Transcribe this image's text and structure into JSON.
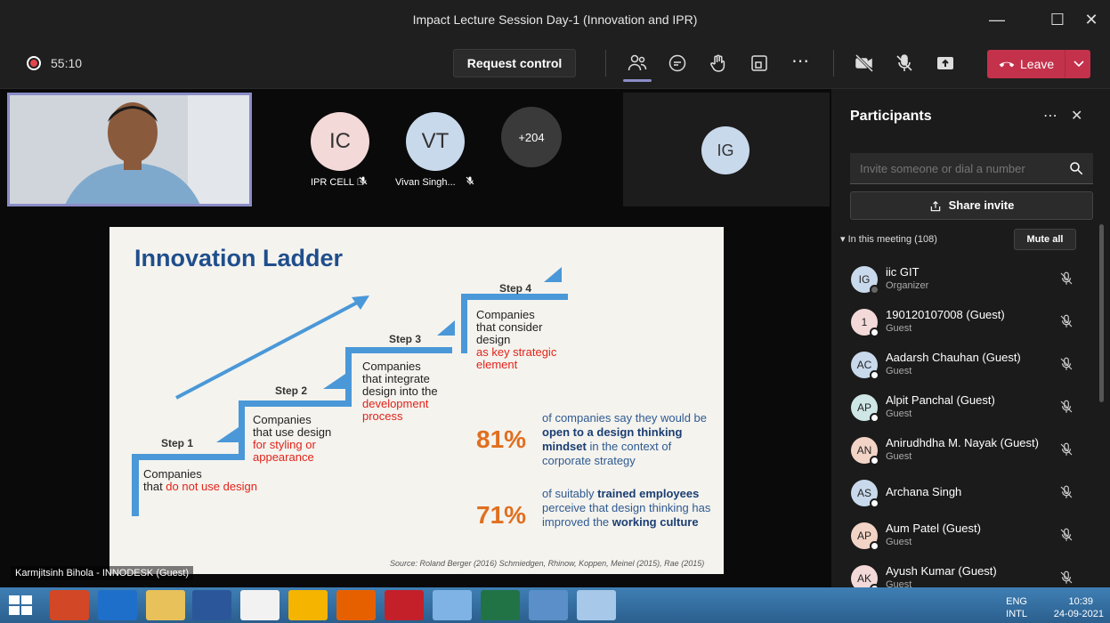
{
  "window": {
    "title": "Impact Lecture Session Day-1 (Innovation and IPR)"
  },
  "toolbar": {
    "timer": "55:10",
    "request_control": "Request control",
    "leave": "Leave"
  },
  "tiles": [
    {
      "initials": "IC",
      "name": "IPR CELL",
      "color": "#f4d9d9"
    },
    {
      "initials": "VT",
      "name": "Vivan Singh...",
      "color": "#c9d9ec"
    },
    {
      "initials": "+204",
      "name": ""
    },
    {
      "initials": "IG",
      "name": "",
      "color": "#c9d9ec"
    }
  ],
  "slide": {
    "title": "Innovation Ladder",
    "steps": [
      {
        "label": "Step 1",
        "text_a": "Companies",
        "text_b": "that ",
        "text_red": "do not use design"
      },
      {
        "label": "Step 2",
        "text_a": "Companies",
        "text_b": "that use design",
        "text_red": "for styling or appearance"
      },
      {
        "label": "Step 3",
        "text_a": "Companies",
        "text_b": "that integrate design into the",
        "text_red": "development process"
      },
      {
        "label": "Step 4",
        "text_a": "Companies",
        "text_b": "that consider design",
        "text_red": "as key strategic element"
      }
    ],
    "stats": [
      {
        "pct": "81%",
        "pre": "of companies say they would be ",
        "bold": "open to a design thinking mindset",
        "post": " in the context of corporate strategy"
      },
      {
        "pct": "71%",
        "pre": "of suitably ",
        "bold": "trained employees",
        "mid": " perceive that design thinking has improved the ",
        "bold2": "working culture"
      }
    ],
    "source": "Source: Roland Berger (2016) Schmiedgen, Rhinow, Koppen, Meinel (2015), Rae (2015)"
  },
  "speaker": "Karmjitsinh Bihola - INNODESK (Guest)",
  "panel": {
    "title": "Participants",
    "invite_placeholder": "Invite someone or dial a number",
    "share_invite": "Share invite",
    "in_meeting": "In this meeting (108)",
    "mute_all": "Mute all",
    "participants": [
      {
        "initials": "IG",
        "name": "iic GIT",
        "role": "Organizer",
        "color": "#c9d9ec"
      },
      {
        "initials": "1",
        "name": "190120107008 (Guest)",
        "role": "Guest",
        "color": "#f4d9d9"
      },
      {
        "initials": "AC",
        "name": "Aadarsh Chauhan (Guest)",
        "role": "Guest",
        "color": "#c9d9ec"
      },
      {
        "initials": "AP",
        "name": "Alpit Panchal (Guest)",
        "role": "Guest",
        "color": "#cfe6e6"
      },
      {
        "initials": "AN",
        "name": "Anirudhdha M. Nayak (Guest)",
        "role": "Guest",
        "color": "#f2d4c6"
      },
      {
        "initials": "AS",
        "name": "Archana Singh",
        "role": "",
        "color": "#c9d9ec"
      },
      {
        "initials": "AP",
        "name": "Aum Patel (Guest)",
        "role": "Guest",
        "color": "#f2d4c6"
      },
      {
        "initials": "AK",
        "name": "Ayush Kumar (Guest)",
        "role": "Guest",
        "color": "#f4d9d9"
      }
    ]
  },
  "system": {
    "lang": "ENG",
    "layout": "INTL",
    "time": "10:39",
    "date": "24-09-2021"
  }
}
